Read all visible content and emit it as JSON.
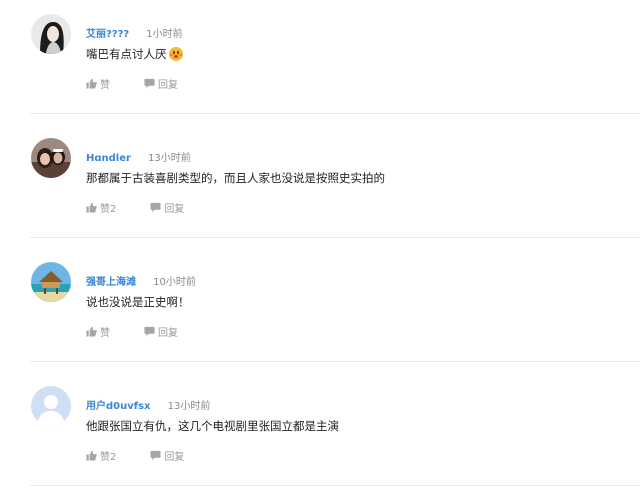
{
  "comments": [
    {
      "username": "艾丽????",
      "time": "1小时前",
      "text": "嘴巴有点讨人厌",
      "like_label": "赞",
      "reply_label": "回复",
      "has_emoji": true
    },
    {
      "username": "Hɑndler",
      "time": "13小时前",
      "text": "那都属于古装喜剧类型的，而且人家也没说是按照史实拍的",
      "like_label": "赞2",
      "reply_label": "回复",
      "has_emoji": false
    },
    {
      "username": "强哥上海滩",
      "time": "10小时前",
      "text": "说也没说是正史啊！",
      "like_label": "赞",
      "reply_label": "回复",
      "has_emoji": false
    },
    {
      "username": "用户d0uvfsx",
      "time": "13小时前",
      "text": "他跟张国立有仇，这几个电视剧里张国立都是主演",
      "like_label": "赞2",
      "reply_label": "回复",
      "has_emoji": false
    }
  ],
  "colors": {
    "username": "#3a86d8",
    "time": "#888888",
    "action": "#999999",
    "divider": "#ebebeb"
  },
  "icons": {
    "like": "thumbs-up-icon",
    "reply": "comment-bubble-icon"
  }
}
